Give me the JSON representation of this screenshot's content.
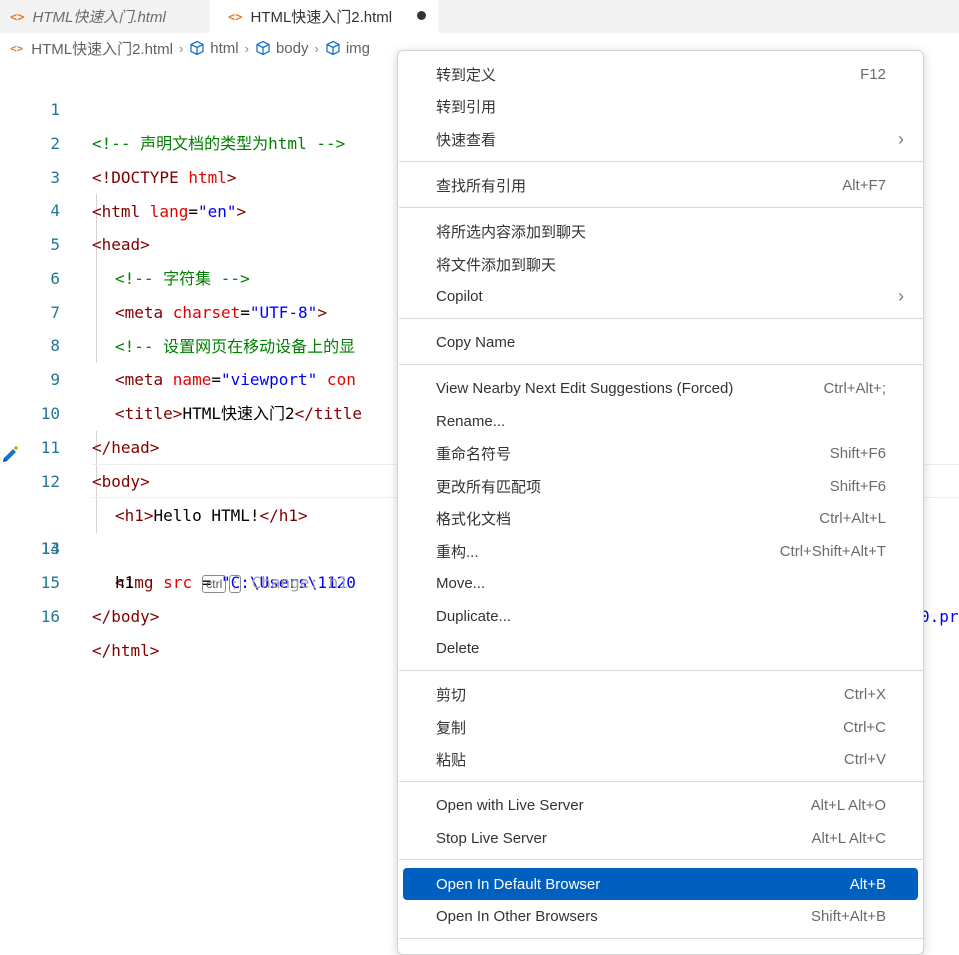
{
  "tabs": [
    {
      "label": "HTML快速入门.html",
      "icon": "html-file-icon"
    },
    {
      "label": "HTML快速入门2.html",
      "icon": "html-file-icon",
      "dirty": true
    }
  ],
  "breadcrumb": [
    "HTML快速入门2.html",
    "html",
    "body",
    "img"
  ],
  "code_lines": [
    {
      "num": "1"
    },
    {
      "num": "2"
    },
    {
      "num": "3"
    },
    {
      "num": "4"
    },
    {
      "num": "5"
    },
    {
      "num": "6"
    },
    {
      "num": "7"
    },
    {
      "num": "8"
    },
    {
      "num": "9"
    },
    {
      "num": "10"
    },
    {
      "num": "11"
    },
    {
      "num": "12"
    },
    {
      "num": "13"
    },
    {
      "num": "14"
    },
    {
      "num": "15"
    },
    {
      "num": "16"
    }
  ],
  "code": {
    "l1": "<!-- 声明文档的类型为html -->",
    "l2a": "<!DOCTYPE ",
    "l2b": "html",
    "l2c": ">",
    "l3a": "<html ",
    "l3b": "lang",
    "l3c": "=",
    "l3d": "\"en\"",
    "l3e": ">",
    "l4": "<head>",
    "l5": "<!-- 字符集 -->",
    "l6a": "<meta ",
    "l6b": "charset",
    "l6c": "=",
    "l6d": "\"UTF-8\"",
    "l6e": ">",
    "l7": "<!-- 设置网页在移动设备上的显",
    "l8a": "<meta ",
    "l8b": "name",
    "l8c": "=",
    "l8d": "\"viewport\"",
    "l8e": " con",
    "l9a": "<title>",
    "l9b": "HTML快速入门2",
    "l9c": "</title",
    "l10": "</head>",
    "l11": "<body>",
    "l12a": "<h1>",
    "l12b": "Hello HTML!",
    "l12c": "</h1>",
    "l13a": "<img ",
    "l13b": "src",
    "l13c": " = ",
    "l13d": "\"C:\\Users\\1120",
    "l13tail": "0.pr",
    "l14a": "h1",
    "l14kbd1": "ctrl",
    "l14kbd2": ";",
    "l14ghost": "Change: h1",
    "l15": "</body>",
    "l16": "</html>"
  },
  "menu": {
    "items": [
      {
        "label": "转到定义",
        "key": "F12"
      },
      {
        "label": "转到引用",
        "key": ""
      },
      {
        "label": "快速查看",
        "key": "",
        "submenu": true
      },
      {
        "label": "查找所有引用",
        "key": "Alt+F7"
      },
      {
        "label": "将所选内容添加到聊天",
        "key": ""
      },
      {
        "label": "将文件添加到聊天",
        "key": ""
      },
      {
        "label": "Copilot",
        "key": "",
        "submenu": true
      },
      {
        "label": "Copy Name",
        "key": ""
      },
      {
        "label": "View Nearby Next Edit Suggestions (Forced)",
        "key": "Ctrl+Alt+;"
      },
      {
        "label": "Rename...",
        "key": ""
      },
      {
        "label": "重命名符号",
        "key": "Shift+F6"
      },
      {
        "label": "更改所有匹配项",
        "key": "Shift+F6"
      },
      {
        "label": "格式化文档",
        "key": "Ctrl+Alt+L"
      },
      {
        "label": "重构...",
        "key": "Ctrl+Shift+Alt+T"
      },
      {
        "label": "Move...",
        "key": ""
      },
      {
        "label": "Duplicate...",
        "key": ""
      },
      {
        "label": "Delete",
        "key": ""
      },
      {
        "label": "剪切",
        "key": "Ctrl+X"
      },
      {
        "label": "复制",
        "key": "Ctrl+C"
      },
      {
        "label": "粘贴",
        "key": "Ctrl+V"
      },
      {
        "label": "Open with Live Server",
        "key": "Alt+L Alt+O"
      },
      {
        "label": "Stop Live Server",
        "key": "Alt+L Alt+C"
      },
      {
        "label": "Open In Default Browser",
        "key": "Alt+B",
        "selected": true
      },
      {
        "label": "Open In Other Browsers",
        "key": "Shift+Alt+B"
      }
    ],
    "submenu_glyph": "›"
  },
  "colors": {
    "accent_selected": "#0060c0",
    "line_number": "#237893",
    "html_icon": "#e37933"
  }
}
